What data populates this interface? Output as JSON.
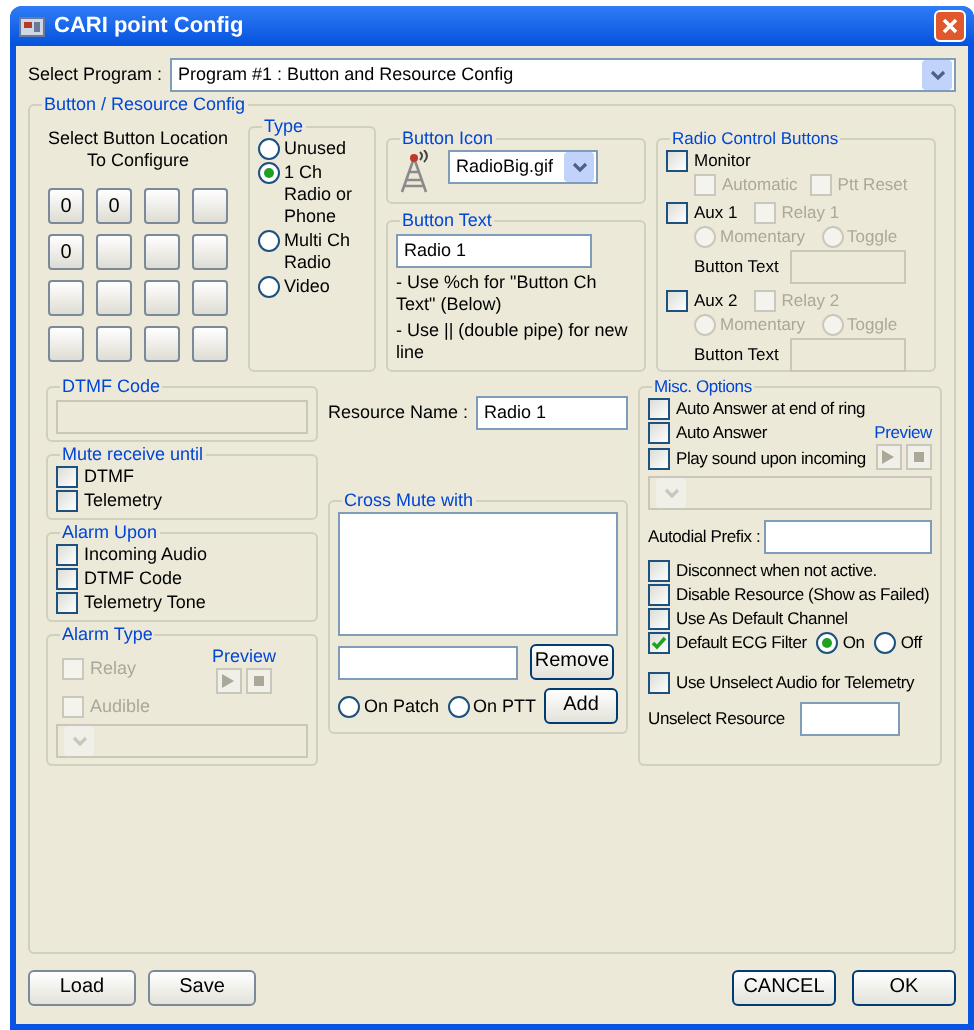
{
  "window": {
    "title": "CARI point Config"
  },
  "program": {
    "label": "Select Program :",
    "value": "Program #1 : Button and Resource Config"
  },
  "config_group": {
    "title": "Button / Resource Config"
  },
  "button_location": {
    "title": "Select Button Location To Configure",
    "buttons": [
      {
        "kind": "numbered",
        "label": "0"
      },
      {
        "kind": "numbered",
        "label": "0"
      },
      {
        "kind": "blank"
      },
      {
        "kind": "blank"
      },
      {
        "kind": "numbered",
        "label": "0"
      },
      {
        "kind": "blank"
      },
      {
        "kind": "blank"
      },
      {
        "kind": "blank"
      },
      {
        "kind": "blank"
      },
      {
        "kind": "blank"
      },
      {
        "kind": "blank"
      },
      {
        "kind": "blank"
      },
      {
        "kind": "blank"
      },
      {
        "kind": "blank"
      },
      {
        "kind": "blank"
      },
      {
        "kind": "blank"
      }
    ]
  },
  "type": {
    "title": "Type",
    "options": [
      {
        "label": "Unused",
        "selected": false
      },
      {
        "label": "1 Ch Radio or Phone",
        "selected": true
      },
      {
        "label": "Multi Ch Radio",
        "selected": false
      },
      {
        "label": "Video",
        "selected": false
      }
    ]
  },
  "button_icon": {
    "title": "Button Icon",
    "file": "RadioBig.gif"
  },
  "button_text": {
    "title": "Button Text",
    "value": "Radio 1",
    "hints": [
      "- Use %ch for \"Button Ch Text\" (Below)",
      "- Use || (double pipe) for new line"
    ]
  },
  "radio_control": {
    "title": "Radio Control Buttons",
    "monitor": {
      "label": "Monitor",
      "checked": false,
      "options": [
        {
          "label": "Automatic",
          "checked": false,
          "disabled": true
        },
        {
          "label": "Ptt Reset",
          "checked": false,
          "disabled": true
        }
      ]
    },
    "aux": [
      {
        "label": "Aux 1",
        "checked": false,
        "relay": {
          "label": "Relay 1",
          "checked": false,
          "disabled": true
        },
        "modes": [
          {
            "label": "Momentary",
            "selected": false,
            "disabled": true
          },
          {
            "label": "Toggle",
            "selected": false,
            "disabled": true
          }
        ],
        "text_label": "Button Text",
        "field_disabled": true
      },
      {
        "label": "Aux 2",
        "checked": false,
        "relay": {
          "label": "Relay 2",
          "checked": false,
          "disabled": true
        },
        "modes": [
          {
            "label": "Momentary",
            "selected": false,
            "disabled": true
          },
          {
            "label": "Toggle",
            "selected": false,
            "disabled": true
          }
        ],
        "text_label": "Button Text",
        "field_disabled": true
      }
    ]
  },
  "dtmf_code": {
    "title": "DTMF Code",
    "field_disabled": true
  },
  "mute_receive": {
    "title": "Mute receive until",
    "options": [
      {
        "label": "DTMF",
        "checked": false
      },
      {
        "label": "Telemetry",
        "checked": false
      }
    ]
  },
  "alarm_upon": {
    "title": "Alarm Upon",
    "options": [
      {
        "label": "Incoming Audio",
        "checked": false
      },
      {
        "label": "DTMF Code",
        "checked": false
      },
      {
        "label": "Telemetry Tone",
        "checked": false
      }
    ]
  },
  "alarm_type": {
    "title": "Alarm Type",
    "options": [
      {
        "label": "Relay",
        "checked": false,
        "disabled": true
      },
      {
        "label": "Audible",
        "checked": false,
        "disabled": true
      }
    ],
    "preview_label": "Preview",
    "dropdown_disabled": true
  },
  "resource_name": {
    "label": "Resource Name :",
    "value": "Radio 1"
  },
  "cross_mute": {
    "title": "Cross Mute with",
    "modes": [
      {
        "label": "On Patch",
        "selected": false
      },
      {
        "label": "On PTT",
        "selected": false
      }
    ],
    "remove_button": "Remove",
    "add_button": "Add"
  },
  "misc": {
    "title": "Misc. Options",
    "options": [
      {
        "label": "Auto Answer at end of ring",
        "checked": false
      },
      {
        "label": "Auto Answer",
        "checked": false
      },
      {
        "label": "Play sound upon incoming",
        "checked": false
      }
    ],
    "preview_label": "Preview",
    "dropdown_disabled": true,
    "autodial_label": "Autodial Prefix :",
    "flags": [
      {
        "label": "Disconnect when not active.",
        "checked": false
      },
      {
        "label": "Disable Resource (Show as Failed)",
        "checked": false
      },
      {
        "label": "Use As Default Channel",
        "checked": false
      },
      {
        "label": "Default ECG Filter",
        "checked": true
      }
    ],
    "ecg_modes": [
      {
        "label": "On",
        "selected": true
      },
      {
        "label": "Off",
        "selected": false
      }
    ],
    "telemetry": {
      "label": "Use Unselect Audio for Telemetry",
      "checked": false
    },
    "unselect_label": "Unselect Resource"
  },
  "footer": {
    "left_buttons": [
      "Load",
      "Save"
    ],
    "right_buttons": [
      "CANCEL",
      "OK"
    ]
  }
}
